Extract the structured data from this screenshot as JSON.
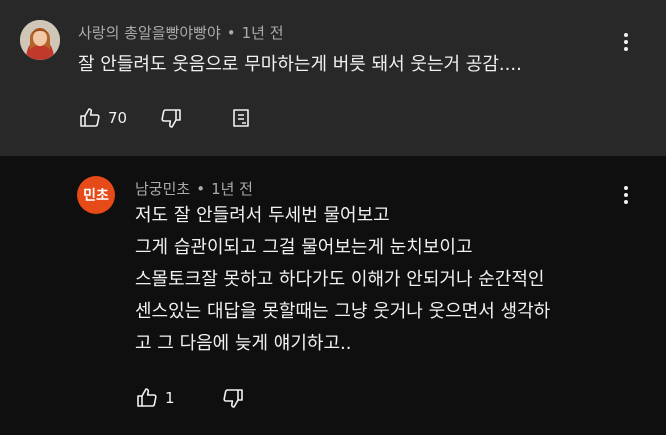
{
  "comment": {
    "author": "사랑의 총알을빵야빵야",
    "time": "1년 전",
    "text": "잘 안들려도 웃음으로 무마하는게 버릇 돼서 웃는거 공감....",
    "likes": "70"
  },
  "reply": {
    "avatar_text": "민초",
    "avatar_color": "#e64a19",
    "author": "남궁민초",
    "time": "1년 전",
    "lines": [
      "저도 잘 안들려서 두세번 물어보고",
      "그게 습관이되고 그걸 물어보는게 눈치보이고",
      "스몰토크잘 못하고 하다가도 이해가 안되거나 순간적인",
      "센스있는 대답을 못할때는 그냥 웃거나 웃으면서 생각하",
      "고 그 다음에 늦게 얘기하고.."
    ],
    "likes": "1"
  },
  "icons": [
    "thumbs-up-icon",
    "thumbs-down-icon",
    "reply-icon",
    "more-vert-icon"
  ],
  "colors": {
    "top_bg": "#282828",
    "page_bg": "#0f0f0f",
    "meta_text": "#aaaaaa",
    "text": "#f1f1f1"
  }
}
